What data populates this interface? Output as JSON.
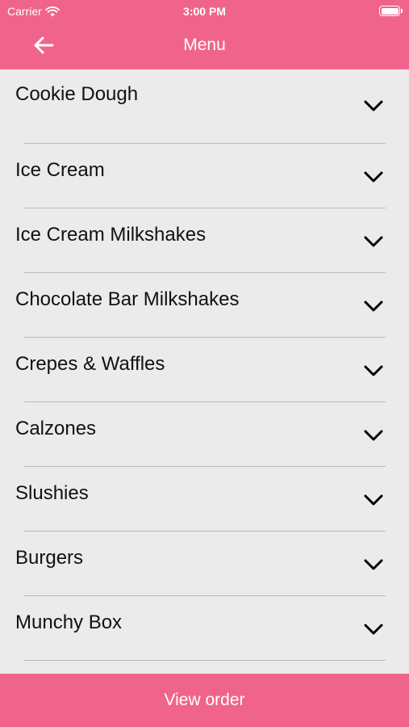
{
  "status_bar": {
    "carrier": "Carrier",
    "time": "3:00 PM"
  },
  "nav": {
    "title": "Menu"
  },
  "menu": {
    "items": [
      {
        "label": "Cookie Dough"
      },
      {
        "label": "Ice Cream"
      },
      {
        "label": "Ice Cream Milkshakes"
      },
      {
        "label": "Chocolate Bar Milkshakes"
      },
      {
        "label": "Crepes & Waffles"
      },
      {
        "label": "Calzones"
      },
      {
        "label": "Slushies"
      },
      {
        "label": "Burgers"
      },
      {
        "label": "Munchy Box"
      }
    ]
  },
  "footer": {
    "view_order_label": "View order"
  },
  "colors": {
    "accent": "#f0648c",
    "background": "#ebebeb",
    "text": "#111111",
    "divider": "#b9b9b9"
  },
  "icons": {
    "back": "arrow-left-icon",
    "expand": "chevron-down-icon",
    "wifi": "wifi-icon",
    "battery": "battery-icon"
  }
}
